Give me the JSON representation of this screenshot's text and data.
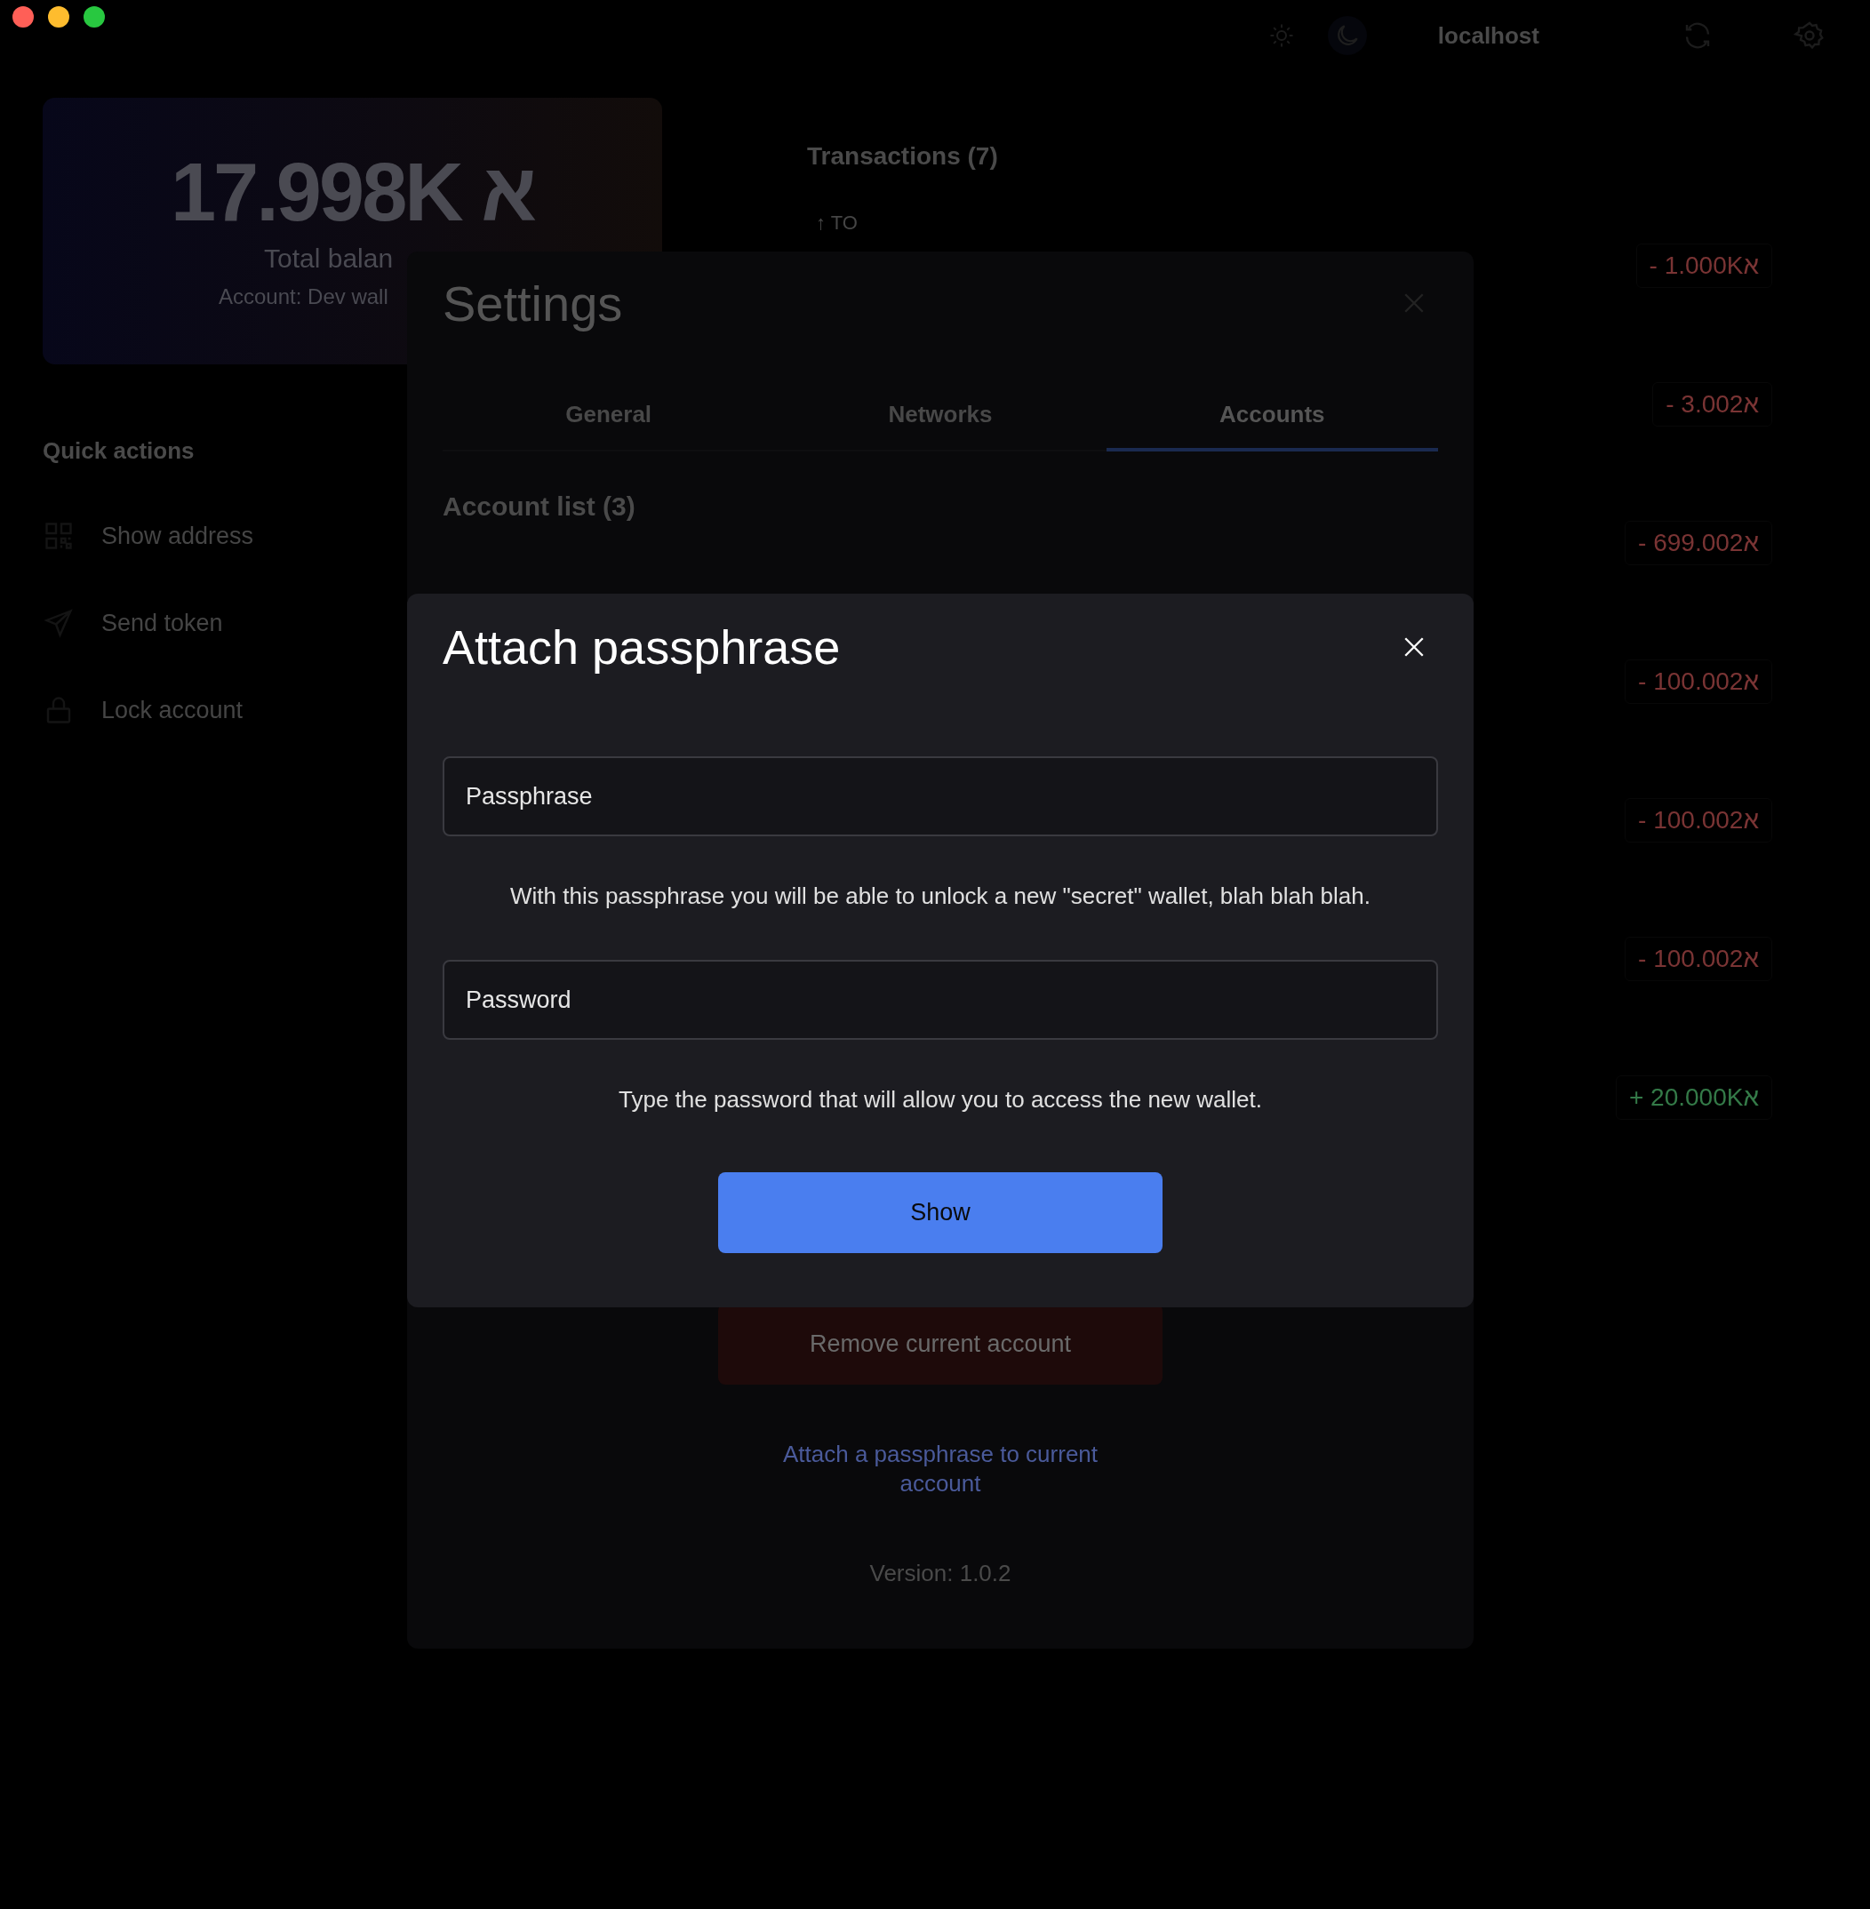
{
  "window": {
    "controls": [
      {
        "color": "#ff5f57"
      },
      {
        "color": "#febc2e"
      },
      {
        "color": "#28c840"
      }
    ]
  },
  "top_bar": {
    "theme_options": [
      {
        "kind": "light",
        "selected": false
      },
      {
        "kind": "dark",
        "selected": true
      }
    ],
    "network": "localhost"
  },
  "balance_card": {
    "amount": "17.998K א",
    "label": "Total balan",
    "account": "Account: Dev wall"
  },
  "quick_actions": {
    "title": "Quick actions",
    "items": [
      {
        "kind": "qr",
        "label": "Show address"
      },
      {
        "kind": "send",
        "label": "Send token"
      },
      {
        "kind": "lock",
        "label": "Lock account"
      }
    ]
  },
  "transactions": {
    "title": "Transactions (7)",
    "direction": "↑ TO",
    "rows": [
      {
        "kind": "outgoing",
        "amount": "- 1.000Kא"
      },
      {
        "kind": "outgoing",
        "amount": "- 3.002א"
      },
      {
        "kind": "outgoing",
        "amount": "- 699.002א"
      },
      {
        "kind": "outgoing",
        "amount": "- 100.002א"
      },
      {
        "kind": "outgoing",
        "amount": "- 100.002א"
      },
      {
        "kind": "outgoing",
        "amount": "- 100.002א"
      },
      {
        "kind": "incoming",
        "amount": "+ 20.000Kא"
      }
    ]
  },
  "settings": {
    "title": "Settings",
    "tabs": [
      {
        "label": "General",
        "selected": false
      },
      {
        "label": "Networks",
        "selected": false
      },
      {
        "label": "Accounts",
        "selected": true
      }
    ],
    "section_title": "Account list (3)",
    "remove_button": "Remove current account",
    "attach_link": "Attach a passphrase to current account",
    "version": "Version: 1.0.2"
  },
  "dialog": {
    "title": "Attach passphrase",
    "fields": [
      {
        "placeholder": "Passphrase",
        "help": "With this passphrase you will be able to unlock a new \"secret\" wallet, blah blah blah."
      },
      {
        "placeholder": "Password",
        "help": "Type the password that will allow you to access the new wallet."
      }
    ],
    "submit": "Show"
  }
}
